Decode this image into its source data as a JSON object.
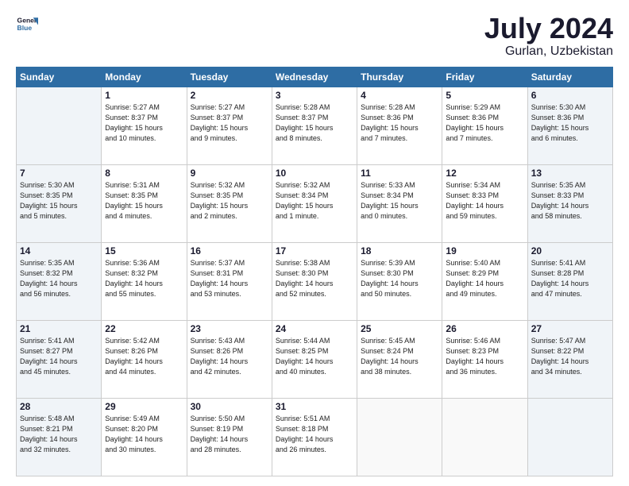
{
  "header": {
    "logo_line1": "General",
    "logo_line2": "Blue",
    "title": "July 2024",
    "subtitle": "Gurlan, Uzbekistan"
  },
  "weekdays": [
    "Sunday",
    "Monday",
    "Tuesday",
    "Wednesday",
    "Thursday",
    "Friday",
    "Saturday"
  ],
  "weeks": [
    [
      {
        "day": "",
        "info": ""
      },
      {
        "day": "1",
        "info": "Sunrise: 5:27 AM\nSunset: 8:37 PM\nDaylight: 15 hours\nand 10 minutes."
      },
      {
        "day": "2",
        "info": "Sunrise: 5:27 AM\nSunset: 8:37 PM\nDaylight: 15 hours\nand 9 minutes."
      },
      {
        "day": "3",
        "info": "Sunrise: 5:28 AM\nSunset: 8:37 PM\nDaylight: 15 hours\nand 8 minutes."
      },
      {
        "day": "4",
        "info": "Sunrise: 5:28 AM\nSunset: 8:36 PM\nDaylight: 15 hours\nand 7 minutes."
      },
      {
        "day": "5",
        "info": "Sunrise: 5:29 AM\nSunset: 8:36 PM\nDaylight: 15 hours\nand 7 minutes."
      },
      {
        "day": "6",
        "info": "Sunrise: 5:30 AM\nSunset: 8:36 PM\nDaylight: 15 hours\nand 6 minutes."
      }
    ],
    [
      {
        "day": "7",
        "info": "Sunrise: 5:30 AM\nSunset: 8:35 PM\nDaylight: 15 hours\nand 5 minutes."
      },
      {
        "day": "8",
        "info": "Sunrise: 5:31 AM\nSunset: 8:35 PM\nDaylight: 15 hours\nand 4 minutes."
      },
      {
        "day": "9",
        "info": "Sunrise: 5:32 AM\nSunset: 8:35 PM\nDaylight: 15 hours\nand 2 minutes."
      },
      {
        "day": "10",
        "info": "Sunrise: 5:32 AM\nSunset: 8:34 PM\nDaylight: 15 hours\nand 1 minute."
      },
      {
        "day": "11",
        "info": "Sunrise: 5:33 AM\nSunset: 8:34 PM\nDaylight: 15 hours\nand 0 minutes."
      },
      {
        "day": "12",
        "info": "Sunrise: 5:34 AM\nSunset: 8:33 PM\nDaylight: 14 hours\nand 59 minutes."
      },
      {
        "day": "13",
        "info": "Sunrise: 5:35 AM\nSunset: 8:33 PM\nDaylight: 14 hours\nand 58 minutes."
      }
    ],
    [
      {
        "day": "14",
        "info": "Sunrise: 5:35 AM\nSunset: 8:32 PM\nDaylight: 14 hours\nand 56 minutes."
      },
      {
        "day": "15",
        "info": "Sunrise: 5:36 AM\nSunset: 8:32 PM\nDaylight: 14 hours\nand 55 minutes."
      },
      {
        "day": "16",
        "info": "Sunrise: 5:37 AM\nSunset: 8:31 PM\nDaylight: 14 hours\nand 53 minutes."
      },
      {
        "day": "17",
        "info": "Sunrise: 5:38 AM\nSunset: 8:30 PM\nDaylight: 14 hours\nand 52 minutes."
      },
      {
        "day": "18",
        "info": "Sunrise: 5:39 AM\nSunset: 8:30 PM\nDaylight: 14 hours\nand 50 minutes."
      },
      {
        "day": "19",
        "info": "Sunrise: 5:40 AM\nSunset: 8:29 PM\nDaylight: 14 hours\nand 49 minutes."
      },
      {
        "day": "20",
        "info": "Sunrise: 5:41 AM\nSunset: 8:28 PM\nDaylight: 14 hours\nand 47 minutes."
      }
    ],
    [
      {
        "day": "21",
        "info": "Sunrise: 5:41 AM\nSunset: 8:27 PM\nDaylight: 14 hours\nand 45 minutes."
      },
      {
        "day": "22",
        "info": "Sunrise: 5:42 AM\nSunset: 8:26 PM\nDaylight: 14 hours\nand 44 minutes."
      },
      {
        "day": "23",
        "info": "Sunrise: 5:43 AM\nSunset: 8:26 PM\nDaylight: 14 hours\nand 42 minutes."
      },
      {
        "day": "24",
        "info": "Sunrise: 5:44 AM\nSunset: 8:25 PM\nDaylight: 14 hours\nand 40 minutes."
      },
      {
        "day": "25",
        "info": "Sunrise: 5:45 AM\nSunset: 8:24 PM\nDaylight: 14 hours\nand 38 minutes."
      },
      {
        "day": "26",
        "info": "Sunrise: 5:46 AM\nSunset: 8:23 PM\nDaylight: 14 hours\nand 36 minutes."
      },
      {
        "day": "27",
        "info": "Sunrise: 5:47 AM\nSunset: 8:22 PM\nDaylight: 14 hours\nand 34 minutes."
      }
    ],
    [
      {
        "day": "28",
        "info": "Sunrise: 5:48 AM\nSunset: 8:21 PM\nDaylight: 14 hours\nand 32 minutes."
      },
      {
        "day": "29",
        "info": "Sunrise: 5:49 AM\nSunset: 8:20 PM\nDaylight: 14 hours\nand 30 minutes."
      },
      {
        "day": "30",
        "info": "Sunrise: 5:50 AM\nSunset: 8:19 PM\nDaylight: 14 hours\nand 28 minutes."
      },
      {
        "day": "31",
        "info": "Sunrise: 5:51 AM\nSunset: 8:18 PM\nDaylight: 14 hours\nand 26 minutes."
      },
      {
        "day": "",
        "info": ""
      },
      {
        "day": "",
        "info": ""
      },
      {
        "day": "",
        "info": ""
      }
    ]
  ]
}
